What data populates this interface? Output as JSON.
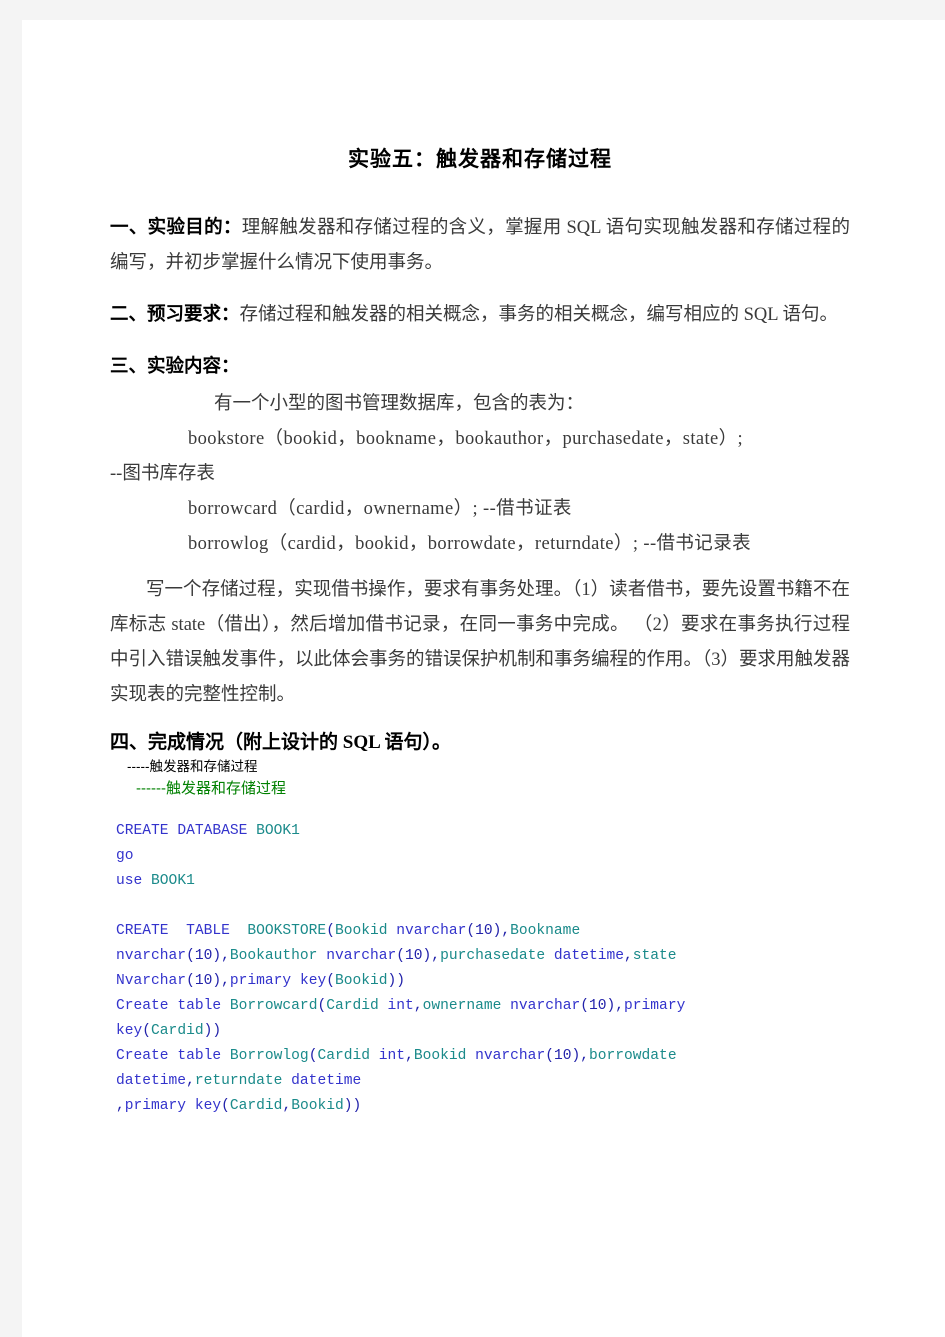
{
  "document": {
    "title": "实验五：触发器和存储过程",
    "sections": [
      {
        "lead": "一、实验目的：",
        "text": "理解触发器和存储过程的含义，掌握用 SQL 语句实现触发器和存储过程的编写，并初步掌握什么情况下使用事务。"
      },
      {
        "lead": "二、预习要求：",
        "text": "存储过程和触发器的相关概念，事务的相关概念，编写相应的 SQL 语句。"
      }
    ],
    "content_heading": "三、实验内容：",
    "content_lines": [
      "有一个小型的图书管理数据库，包含的表为：",
      "bookstore（bookid，bookname，bookauthor，purchasedate，state）;",
      "--图书库存表",
      "borrowcard（cardid，ownername）; --借书证表",
      "borrowlog（cardid，bookid，borrowdate，returndate）; --借书记录表"
    ],
    "requirement_paragraph": "写一个存储过程，实现借书操作，要求有事务处理。（1）读者借书，要先设置书籍不在库标志 state（借出），然后增加借书记录，在同一事务中完成。 （2）要求在事务执行过程中引入错误触发事件，以此体会事务的错误保护机制和事务编程的作用。（3）要求用触发器实现表的完整性控制。",
    "completion_heading": "四、完成情况（附上设计的 SQL 语句）。",
    "comments": [
      {
        "text": "-----触发器和存储过程",
        "color": "#000000"
      },
      {
        "text": "------触发器和存储过程",
        "color": "#008000"
      }
    ],
    "code": {
      "colors": {
        "keyword": "#3333cc",
        "identifier": "#1a8a8a",
        "plain": "#2222aa"
      },
      "lines": [
        "CREATE DATABASE BOOK1",
        "go",
        "use BOOK1",
        "",
        "CREATE  TABLE  BOOKSTORE(Bookid nvarchar(10),Bookname",
        "nvarchar(10),Bookauthor nvarchar(10),purchasedate datetime,state",
        "Nvarchar(10),primary key(Bookid))",
        "Create table Borrowcard(Cardid int,ownername nvarchar(10),primary",
        "key(Cardid))",
        "Create table Borrowlog(Cardid int,Bookid nvarchar(10),borrowdate",
        "datetime,returndate datetime",
        ",primary key(Cardid,Bookid))"
      ]
    }
  }
}
